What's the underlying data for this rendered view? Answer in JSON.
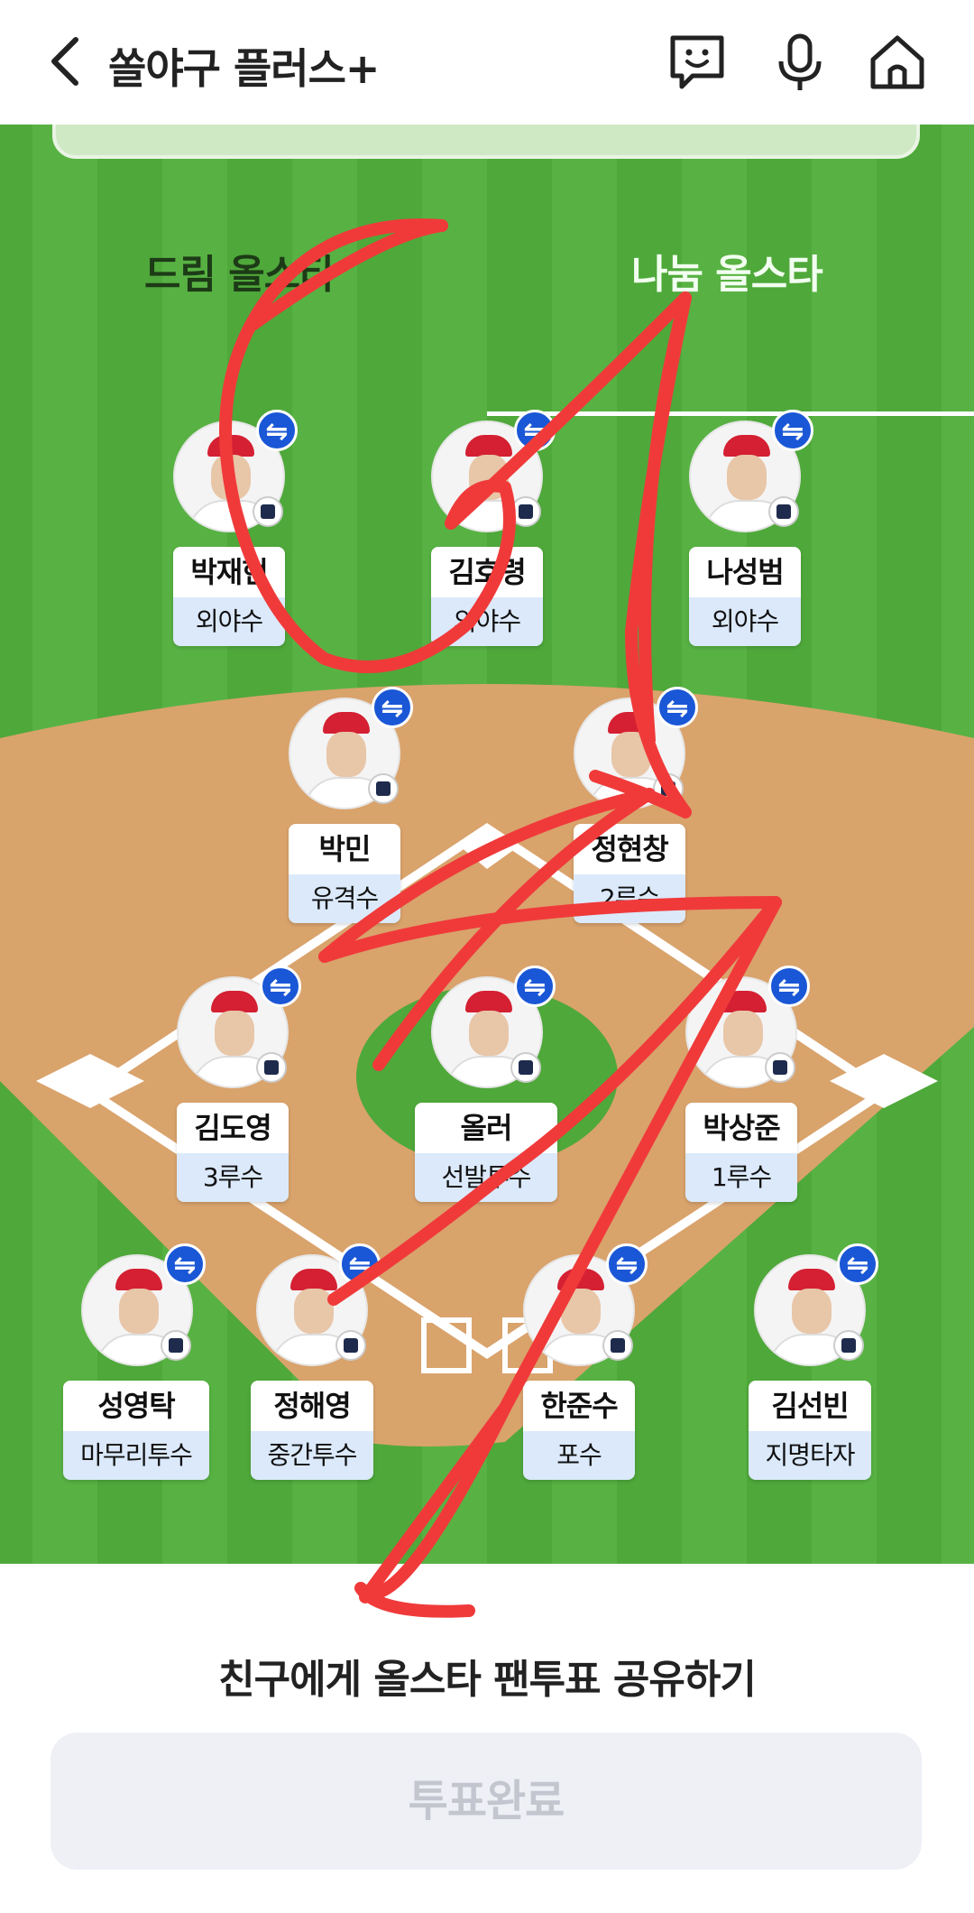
{
  "header": {
    "title": "쏠야구 플러스+",
    "icons": [
      "back-arrow-icon",
      "chatbot-icon",
      "microphone-icon",
      "home-icon"
    ]
  },
  "tabs": [
    {
      "label": "드림 올스타",
      "active": false
    },
    {
      "label": "나눔 올스타",
      "active": true
    }
  ],
  "players": [
    {
      "name": "박재현",
      "position": "외야수"
    },
    {
      "name": "김호령",
      "position": "외야수"
    },
    {
      "name": "나성범",
      "position": "외야수"
    },
    {
      "name": "박민",
      "position": "유격수"
    },
    {
      "name": "정현창",
      "position": "2루수"
    },
    {
      "name": "김도영",
      "position": "3루수"
    },
    {
      "name": "올러",
      "position": "선발투수"
    },
    {
      "name": "박상준",
      "position": "1루수"
    },
    {
      "name": "성영탁",
      "position": "마무리투수"
    },
    {
      "name": "정해영",
      "position": "중간투수"
    },
    {
      "name": "한준수",
      "position": "포수"
    },
    {
      "name": "김선빈",
      "position": "지명타자"
    }
  ],
  "swap_symbol": "⇋",
  "share_text": "친구에게 올스타 팬투표 공유하기",
  "vote_button": "투표완료",
  "colors": {
    "field_green": "#4fa83a",
    "infield_dirt": "#d9a36c",
    "swap_badge": "#1a57d6",
    "position_bg": "#dbe9fb",
    "annotation_red": "#f03a3a"
  }
}
